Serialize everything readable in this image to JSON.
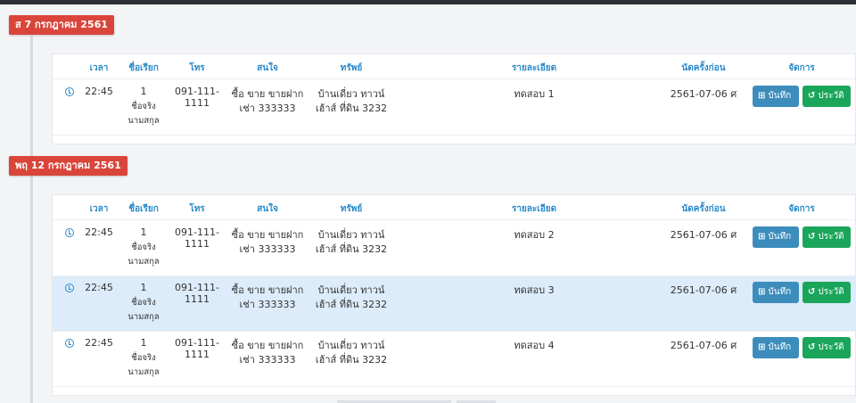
{
  "columns": {
    "time": "เวลา",
    "nickname": "ชื่อเรียก",
    "phone": "โทร",
    "interest": "สนใจ",
    "property": "ทรัพย์",
    "detail": "รายละเอียด",
    "last_appt": "นัดครั้งก่อน",
    "manage": "จัดการ"
  },
  "buttons": {
    "save": "บันทึก",
    "history": "ประวัติ"
  },
  "days": [
    {
      "label": "ส 7 กรกฎาคม 2561",
      "rows": [
        {
          "time": "22:45",
          "nickname": "1",
          "realname_1": "ชื่อจริง",
          "realname_2": "นามสกุล",
          "phone": "091-111-1111",
          "interest_1": "ซื้อ ขาย ขายฝาก",
          "interest_2": "เช่า 333333",
          "property_1": "บ้านเดี่ยว ทาวน์",
          "property_2": "เฮ้าส์ ที่ดิน 3232",
          "detail": "ทดสอบ 1",
          "last_appt": "2561-07-06 ศ"
        }
      ]
    },
    {
      "label": "พฤ 12 กรกฎาคม 2561",
      "rows": [
        {
          "time": "22:45",
          "nickname": "1",
          "realname_1": "ชื่อจริง",
          "realname_2": "นามสกุล",
          "phone": "091-111-1111",
          "interest_1": "ซื้อ ขาย ขายฝาก",
          "interest_2": "เช่า 333333",
          "property_1": "บ้านเดี่ยว ทาวน์",
          "property_2": "เฮ้าส์ ที่ดิน 3232",
          "detail": "ทดสอบ 2",
          "last_appt": "2561-07-06 ศ"
        },
        {
          "time": "22:45",
          "nickname": "1",
          "realname_1": "ชื่อจริง",
          "realname_2": "นามสกุล",
          "phone": "091-111-1111",
          "interest_1": "ซื้อ ขาย ขายฝาก",
          "interest_2": "เช่า 333333",
          "property_1": "บ้านเดี่ยว ทาวน์",
          "property_2": "เฮ้าส์ ที่ดิน 3232",
          "detail": "ทดสอบ 3",
          "last_appt": "2561-07-06 ศ"
        },
        {
          "time": "22:45",
          "nickname": "1",
          "realname_1": "ชื่อจริง",
          "realname_2": "นามสกุล",
          "phone": "091-111-1111",
          "interest_1": "ซื้อ ขาย ขายฝาก",
          "interest_2": "เช่า 333333",
          "property_1": "บ้านเดี่ยว ทาวน์",
          "property_2": "เฮ้าส์ ที่ดิน 3232",
          "detail": "ทดสอบ 4",
          "last_appt": "2561-07-06 ศ"
        }
      ]
    }
  ]
}
